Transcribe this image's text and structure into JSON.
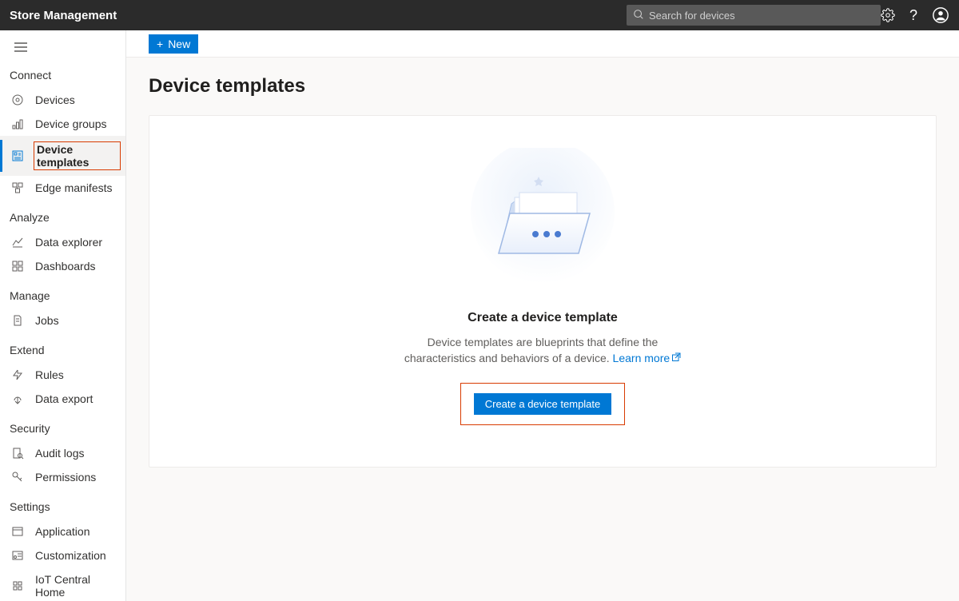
{
  "header": {
    "title": "Store Management",
    "search_placeholder": "Search for devices"
  },
  "sidebar": {
    "sections": [
      {
        "label": "Connect",
        "items": [
          {
            "label": "Devices",
            "icon": "devices"
          },
          {
            "label": "Device groups",
            "icon": "groups"
          },
          {
            "label": "Device templates",
            "icon": "templates",
            "active": true,
            "highlighted": true
          },
          {
            "label": "Edge manifests",
            "icon": "edge"
          }
        ]
      },
      {
        "label": "Analyze",
        "items": [
          {
            "label": "Data explorer",
            "icon": "explorer"
          },
          {
            "label": "Dashboards",
            "icon": "dashboards"
          }
        ]
      },
      {
        "label": "Manage",
        "items": [
          {
            "label": "Jobs",
            "icon": "jobs"
          }
        ]
      },
      {
        "label": "Extend",
        "items": [
          {
            "label": "Rules",
            "icon": "rules"
          },
          {
            "label": "Data export",
            "icon": "export"
          }
        ]
      },
      {
        "label": "Security",
        "items": [
          {
            "label": "Audit logs",
            "icon": "audit"
          },
          {
            "label": "Permissions",
            "icon": "permissions"
          }
        ]
      },
      {
        "label": "Settings",
        "items": [
          {
            "label": "Application",
            "icon": "app"
          },
          {
            "label": "Customization",
            "icon": "custom"
          },
          {
            "label": "IoT Central Home",
            "icon": "home"
          }
        ]
      }
    ]
  },
  "commandbar": {
    "new_label": "New"
  },
  "page": {
    "title": "Device templates",
    "card_title": "Create a device template",
    "card_desc_pre": "Device templates are blueprints that define the characteristics and behaviors of a device. ",
    "learn_more": "Learn more",
    "create_button": "Create a device template"
  }
}
